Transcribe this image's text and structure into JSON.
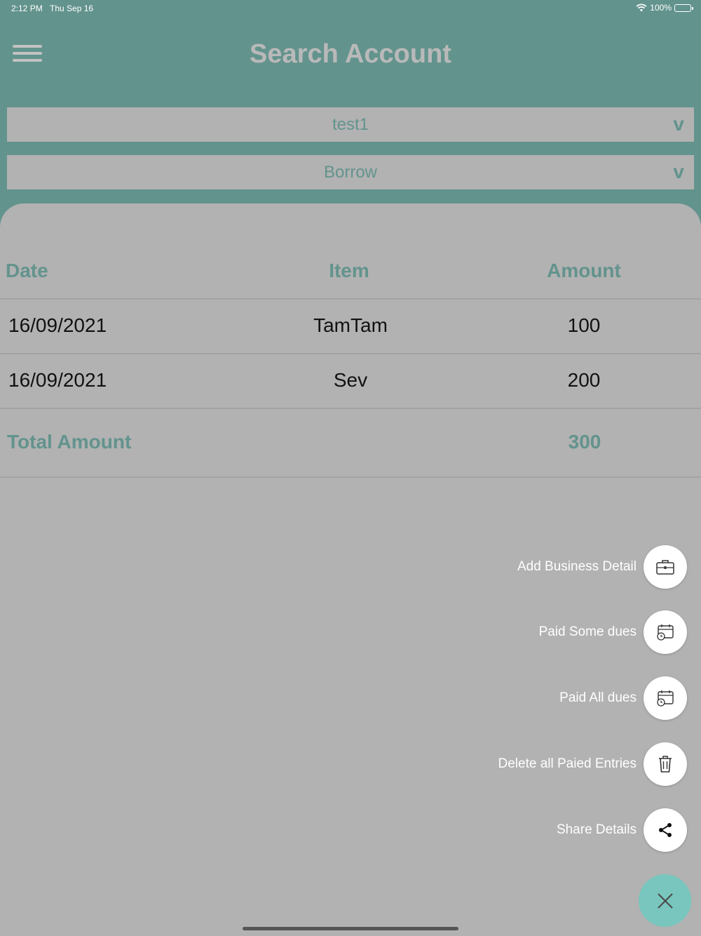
{
  "status_bar": {
    "time": "2:12 PM",
    "date": "Thu Sep 16",
    "battery": "100%"
  },
  "header": {
    "title": "Search Account"
  },
  "filters": {
    "account": {
      "value": "test1",
      "chevron": "v"
    },
    "type": {
      "value": "Borrow",
      "chevron": "v"
    }
  },
  "table": {
    "headers": [
      "Date",
      "Item",
      "Amount"
    ],
    "rows": [
      {
        "date": "16/09/2021",
        "item": "TamTam",
        "amount": "100"
      },
      {
        "date": "16/09/2021",
        "item": "Sev",
        "amount": "200"
      }
    ],
    "total_label": "Total Amount",
    "total_value": "300"
  },
  "fab_menu": {
    "items": [
      {
        "label": "Add Business Detail",
        "icon": "briefcase-icon"
      },
      {
        "label": "Paid Some dues",
        "icon": "calendar-clock-icon"
      },
      {
        "label": "Paid All dues",
        "icon": "calendar-clock-icon"
      },
      {
        "label": "Delete all Paied Entries",
        "icon": "trash-icon"
      },
      {
        "label": "Share  Details",
        "icon": "share-icon"
      }
    ],
    "close_icon": "close-icon"
  },
  "colors": {
    "accent": "#63938d",
    "fab": "#78c6bd",
    "background": "#b2b2b2"
  }
}
